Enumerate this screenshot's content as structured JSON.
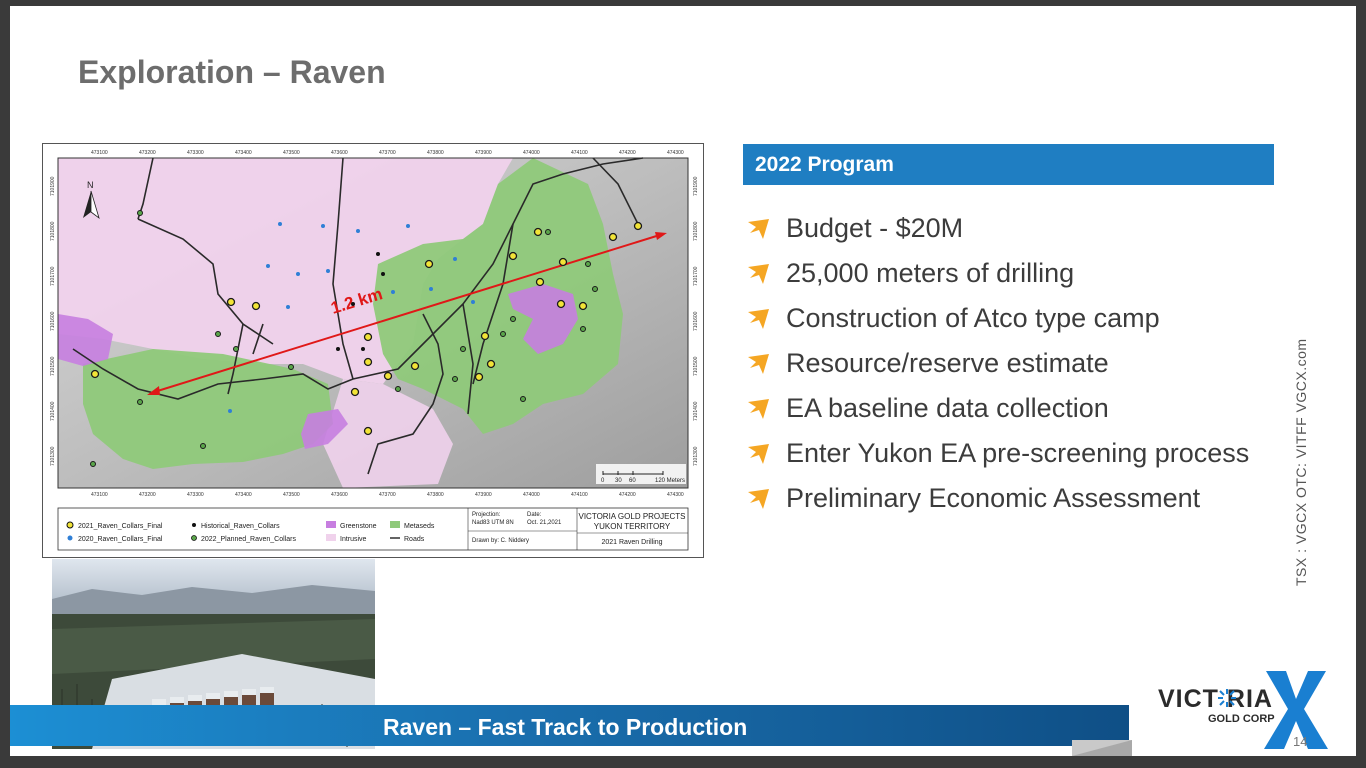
{
  "slide": {
    "title": "Exploration – Raven",
    "program_header": "2022 Program",
    "bullets": [
      "Budget - $20M",
      "25,000 meters of drilling",
      "Construction of Atco type camp",
      "Resource/reserve estimate",
      "EA baseline data collection",
      "Enter Yukon EA pre-screening process",
      "Preliminary Economic Assessment"
    ],
    "side_text": "TSX : VGCX     OTC: VITFF     VGCX.com",
    "footer": "Raven – Fast Track to Production",
    "page_number": "14",
    "logo": {
      "name": "VICT   RIA",
      "sub": "GOLD CORP"
    }
  },
  "map": {
    "distance_label": "1.2 km",
    "north_label": "N",
    "top_ticks": [
      "473100",
      "473200",
      "473300",
      "473400",
      "473500",
      "473600",
      "473700",
      "473800",
      "473900",
      "474000",
      "474100",
      "474200",
      "474300"
    ],
    "left_ticks": [
      "7101900",
      "7101800",
      "7101700",
      "7101600",
      "7101500",
      "7101400",
      "7101300"
    ],
    "scale_ticks": [
      "0",
      "30",
      "60",
      "120 Meters"
    ],
    "legend": {
      "collars_2021": "2021_Raven_Collars_Final",
      "collars_2020": "2020_Raven_Collars_Final",
      "historical": "Historical_Raven_Collars",
      "planned_2022": "2022_Planned_Raven_Collars",
      "greenstone": "Greenstone",
      "intrusive": "Intrusive",
      "metaseds": "Metaseds",
      "roads": "Roads"
    },
    "info": {
      "projection_label": "Projection:",
      "projection_value": "Nad83 UTM 8N",
      "date_label": "Date:",
      "date_value": "Oct. 21,2021",
      "drawn_by": "Drawn by: C. Niddery",
      "project_title_1": "VICTORIA GOLD PROJECTS",
      "project_title_2": "YUKON TERRITORY",
      "project_subtitle": "2021 Raven Drilling"
    }
  },
  "colors": {
    "accent_blue": "#1f7ec2",
    "bullet_orange": "#f5a623",
    "metaseds": "#8fc97a",
    "intrusive": "#f0d2ec",
    "greenstone": "#c77ee0",
    "logo_blue": "#1a7fd1"
  }
}
